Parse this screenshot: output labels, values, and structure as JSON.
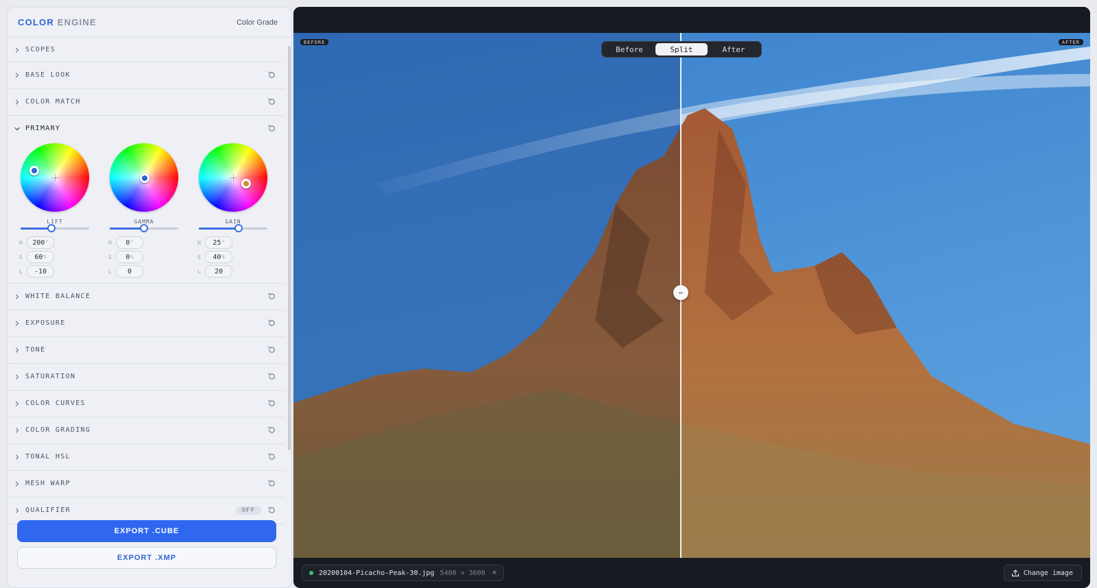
{
  "panel": {
    "brand_primary": "COLOR",
    "brand_secondary": "ENGINE",
    "header_right": "Color Grade"
  },
  "sections": [
    {
      "label": "SCOPES",
      "expanded": false,
      "has_reset": false
    },
    {
      "label": "BASE LOOK",
      "expanded": false,
      "has_reset": true
    },
    {
      "label": "COLOR MATCH",
      "expanded": false,
      "has_reset": true
    },
    {
      "label": "PRIMARY",
      "expanded": true,
      "has_reset": true
    },
    {
      "label": "WHITE BALANCE",
      "expanded": false,
      "has_reset": true
    },
    {
      "label": "EXPOSURE",
      "expanded": false,
      "has_reset": true
    },
    {
      "label": "TONE",
      "expanded": false,
      "has_reset": true
    },
    {
      "label": "SATURATION",
      "expanded": false,
      "has_reset": true
    },
    {
      "label": "COLOR CURVES",
      "expanded": false,
      "has_reset": true
    },
    {
      "label": "COLOR GRADING",
      "expanded": false,
      "has_reset": true
    },
    {
      "label": "TONAL HSL",
      "expanded": false,
      "has_reset": true
    },
    {
      "label": "MESH WARP",
      "expanded": false,
      "has_reset": true
    },
    {
      "label": "QUALIFIER",
      "expanded": false,
      "has_reset": true,
      "badge": "OFF"
    }
  ],
  "wheels": [
    {
      "label": "LIFT",
      "h": "200",
      "h_unit": "°",
      "s": "60",
      "s_unit": "%",
      "l": "-10",
      "slider_fraction": 0.45,
      "puck_color": "#2f63d8"
    },
    {
      "label": "GAMMA",
      "h": "0",
      "h_unit": "°",
      "s": "0",
      "s_unit": "%",
      "l": "0",
      "slider_fraction": 0.5,
      "puck_color": "#2f63d8"
    },
    {
      "label": "GAIN",
      "h": "25",
      "h_unit": "°",
      "s": "40",
      "s_unit": "%",
      "l": "20",
      "slider_fraction": 0.58,
      "puck_color": "#d98a3a"
    }
  ],
  "field_keys": {
    "h": "H",
    "s": "S",
    "l": "L"
  },
  "buttons": {
    "export_cube": "EXPORT .CUBE",
    "export_xmp": "EXPORT .XMP"
  },
  "viewer": {
    "mode_options": [
      "Before",
      "Split",
      "After"
    ],
    "mode_selected": "Split",
    "before_tag": "BEFORE",
    "after_tag": "AFTER",
    "split_position": 0.5,
    "file_name": "20200104-Picacho-Peak-30.jpg",
    "file_dims": "5400 × 3600",
    "close_glyph": "×",
    "handle_glyph": "◂▸",
    "change_image_label": "Change image"
  },
  "colors": {
    "accent": "#2f68ef",
    "status_dot": "#3cc37a"
  },
  "icons": [
    "chevron-right-icon",
    "chevron-down-icon",
    "reset-icon",
    "upload-icon",
    "close-icon"
  ]
}
